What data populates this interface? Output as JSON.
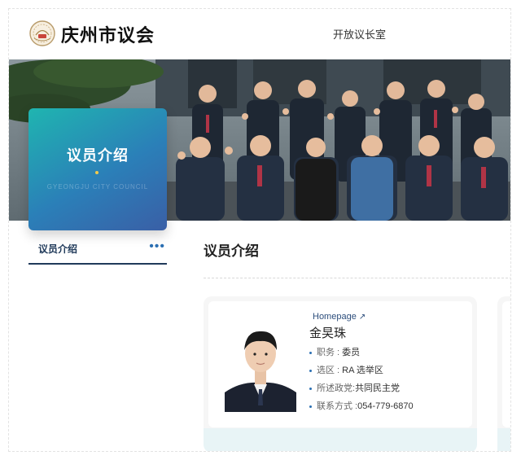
{
  "header": {
    "site_title": "庆州市议会",
    "logo_icon": "council-seal-icon",
    "top_link": "开放议长室"
  },
  "banner": {
    "image": "council-members-group-photo"
  },
  "section_card": {
    "title": "议员介绍",
    "subtitle": "GYEONGJU CITY COUNCIL"
  },
  "sidebar": {
    "items": [
      {
        "label": "议员介绍",
        "icon": "more-dots-icon"
      }
    ]
  },
  "content": {
    "title": "议员介绍",
    "members": [
      {
        "name": "金旲珠",
        "info": [
          {
            "label": "职务 : ",
            "value": "委员"
          },
          {
            "label": "选区 : ",
            "value": "RA 选举区"
          },
          {
            "label": "所述政党:",
            "value": "共同民主党"
          },
          {
            "label": "联系方式 :",
            "value": "054-779-6870"
          }
        ],
        "homepage_label": "Homepage",
        "homepage_icon": "external-link-icon"
      }
    ]
  },
  "colors": {
    "card_gradient_start": "#1fb5b0",
    "card_gradient_end": "#3a5fa6",
    "nav_underline": "#203a5a",
    "accent_blue": "#2b6fb2",
    "homepage_bar": "#e8f4f6"
  }
}
